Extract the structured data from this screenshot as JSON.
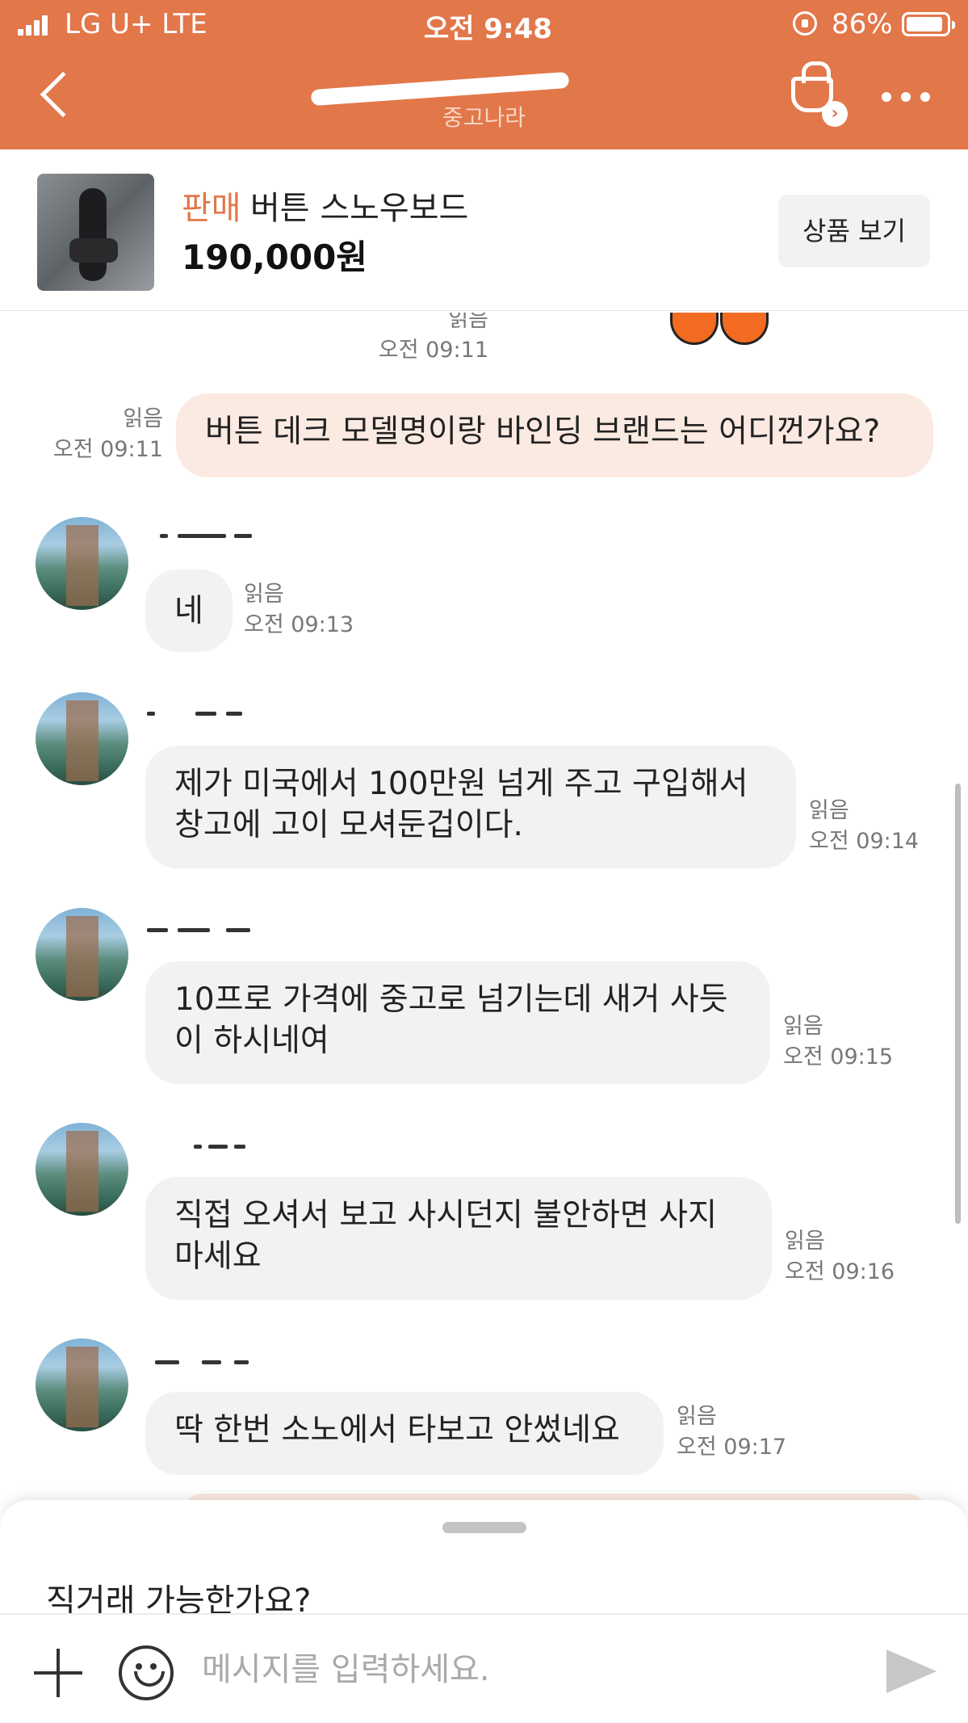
{
  "status_bar": {
    "carrier": "LG U+  LTE",
    "time": "오전 9:48",
    "battery": "86%"
  },
  "header": {
    "subtitle": "중고나라"
  },
  "product": {
    "tag": "판매",
    "title": "버튼 스노우보드",
    "price": "190,000원",
    "view_button": "상품 보기"
  },
  "chat": {
    "top_meta": {
      "read": "읽음",
      "time": "오전 09:11"
    },
    "messages": [
      {
        "from": "me",
        "text": "버튼 데크 모델명이랑 바인딩 브랜드는 어디껀가요?",
        "read": "읽음",
        "time": "오전 09:11"
      },
      {
        "from": "them",
        "text": "네",
        "read": "읽음",
        "time": "오전 09:13"
      },
      {
        "from": "them",
        "text": "제가 미국에서 100만원 넘게 주고 구입해서\n창고에 고이 모셔둔겁이다.",
        "read": "읽음",
        "time": "오전 09:14"
      },
      {
        "from": "them",
        "text": "10프로 가격에 중고로 넘기는데 새거 사듯\n이 하시네여",
        "read": "읽음",
        "time": "오전 09:15"
      },
      {
        "from": "them",
        "text": "직접 오셔서 보고 사시던지 불안하면 사지\n마세요",
        "read": "읽음",
        "time": "오전 09:16"
      },
      {
        "from": "them",
        "text": "딱 한번 소노에서 타보고 안썼네요",
        "read": "읽음",
        "time": "오전 09:17"
      }
    ]
  },
  "quick_reply": "직거래 가능한가요?",
  "composer": {
    "placeholder": "메시지를 입력하세요."
  },
  "colors": {
    "brand": "#e2774a",
    "my_bubble": "#fbeae2",
    "their_bubble": "#f2f2f3"
  },
  "icons": [
    "back-icon",
    "basket-icon",
    "more-icon",
    "plus-icon",
    "emoji-icon",
    "send-icon"
  ]
}
